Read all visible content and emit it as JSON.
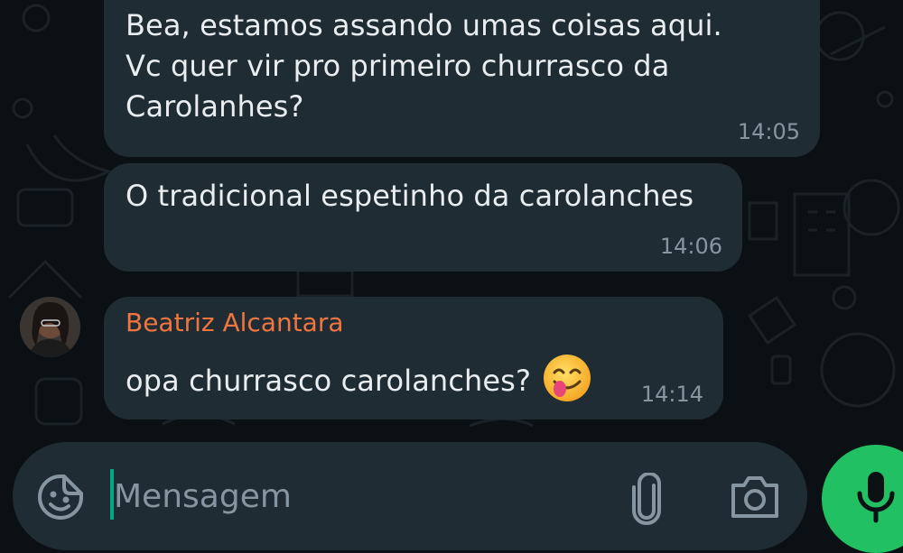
{
  "colors": {
    "background": "#0b1014",
    "bubble": "#1f2c34",
    "text": "#e9edef",
    "meta": "#8696a0",
    "sender_name": "#f0753e",
    "accent_green": "#21c063"
  },
  "messages": [
    {
      "text": "Bea, estamos assando umas coisas aqui.\nVc quer vir pro primeiro churrasco da\nCarolanhes?",
      "time": "14:05"
    },
    {
      "text": "O tradicional espetinho da carolanches",
      "time": "14:06"
    },
    {
      "sender": "Beatriz Alcantara",
      "text": "opa churrasco carolanches?",
      "emoji": "😋",
      "time": "14:14"
    }
  ],
  "composer": {
    "placeholder": "Mensagem",
    "value": "",
    "icons": [
      "sticker-icon",
      "attach-icon",
      "camera-icon",
      "mic-icon"
    ]
  }
}
